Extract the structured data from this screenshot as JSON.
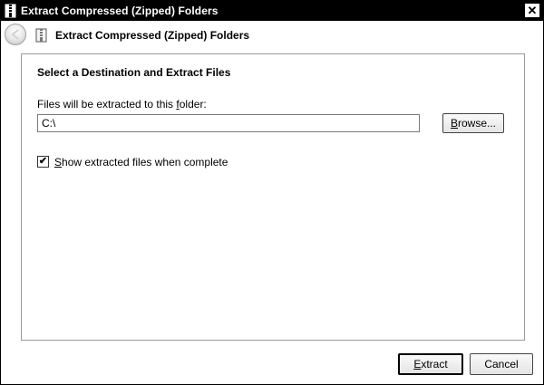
{
  "window": {
    "title": "Extract Compressed (Zipped) Folders",
    "close_glyph": "✕"
  },
  "header": {
    "title": "Extract Compressed (Zipped) Folders"
  },
  "content": {
    "heading": "Select a Destination and Extract Files",
    "folder_label_prefix": "Files will be extracted to this ",
    "folder_label_accesskey": "f",
    "folder_label_suffix": "older:",
    "destination_path": "C:\\",
    "browse_prefix": "",
    "browse_accesskey": "B",
    "browse_suffix": "rowse...",
    "show_files_checked": true,
    "show_files_check_glyph": "✔",
    "show_files_accesskey": "S",
    "show_files_suffix": "how extracted files when complete"
  },
  "footer": {
    "extract_accesskey": "E",
    "extract_suffix": "xtract",
    "cancel_label": "Cancel"
  },
  "icons": {
    "window_icon": "zip-folder-icon",
    "header_icon": "zip-folder-icon",
    "back": "back-arrow-icon"
  }
}
